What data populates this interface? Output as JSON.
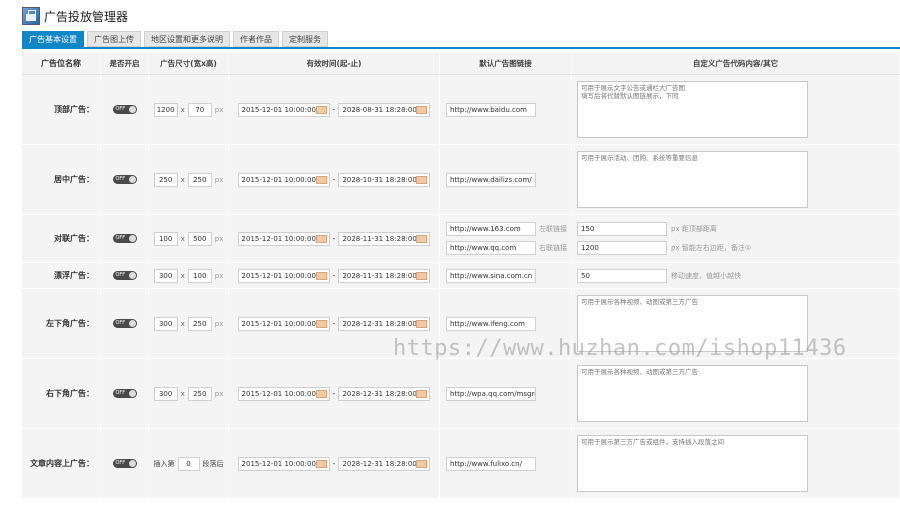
{
  "app": {
    "title": "广告投放管理器"
  },
  "tabs": [
    {
      "label": "广告基本设置"
    },
    {
      "label": "广告图上传"
    },
    {
      "label": "地区设置和更多说明"
    },
    {
      "label": "作者作品"
    },
    {
      "label": "定制服务"
    }
  ],
  "columns": {
    "name": "广告位名称",
    "enabled": "是否开启",
    "size": "广告尺寸(宽x高)",
    "time": "有效时间(起-止)",
    "link": "默认广告图链接",
    "custom": "自定义广告代码内容/其它"
  },
  "toggle_label": "OFF",
  "size_sep": "x",
  "size_unit": "px",
  "date_dash": "-",
  "rows": [
    {
      "name": "顶部广告：",
      "w": "1200",
      "h": "70",
      "start": "2015-12-01 10:00:00",
      "end": "2028-08-31 18:28:00",
      "link": "http://www.baidu.com",
      "custom": "可用于展示文字公告或通栏大广告图\n填写后将代替默认图链展示，下同"
    },
    {
      "name": "居中广告：",
      "w": "250",
      "h": "250",
      "start": "2015-12-01 10:00:00",
      "end": "2028-10-31 18:28:00",
      "link": "http://www.dailizs.com/",
      "custom": "可用于展示活动、团购、系统等重要信息"
    },
    {
      "name": "对联广告：",
      "w": "100",
      "h": "500",
      "start": "2015-12-01 10:00:00",
      "end": "2028-11-31 18:28:00",
      "link_left": "http://www.163.com",
      "link_left_label": "左联链接",
      "link_right": "http://www.qq.com",
      "link_right_label": "右联链接",
      "top_distance": "150",
      "top_distance_note": "距顶部距离",
      "side_distance": "1200",
      "side_distance_note": "智能左右边距，备注①"
    },
    {
      "name": "漂浮广告：",
      "w": "300",
      "h": "100",
      "start": "2015-12-01 10:00:00",
      "end": "2028-11-31 18:28:00",
      "link": "http://www.sina.com.cn",
      "speed": "50",
      "speed_note": "移动速度，值越小越快"
    },
    {
      "name": "左下角广告：",
      "w": "300",
      "h": "250",
      "start": "2015-12-01 10:00:00",
      "end": "2028-12-31 18:28:00",
      "link": "http://www.ifeng.com",
      "custom": "可用于展示各种视频、动图或第三方广告"
    },
    {
      "name": "右下角广告：",
      "w": "300",
      "h": "250",
      "start": "2015-12-01 10:00:00",
      "end": "2028-12-31 18:28:00",
      "link": "http://wpa.qq.com/msgrd?v",
      "custom": "可用于展示各种视频、动图或第三方广告"
    },
    {
      "name": "文章内容上广告：",
      "insert_label": "插入第",
      "paragraph": "0",
      "paragraph_label": "段落后",
      "start": "2015-12-01 10:00:00",
      "end": "2028-12-31 18:28:00",
      "link": "http://www.fulixo.cn/",
      "custom": "可用于展示第三方广告或组件，支持插入段落之间"
    }
  ],
  "watermark": "https://www.huzhan.com/ishop11436",
  "colors": {
    "accent": "#1287c8",
    "toggle_off": "#4a4a4a",
    "row_bg": "#f4f4f4"
  }
}
